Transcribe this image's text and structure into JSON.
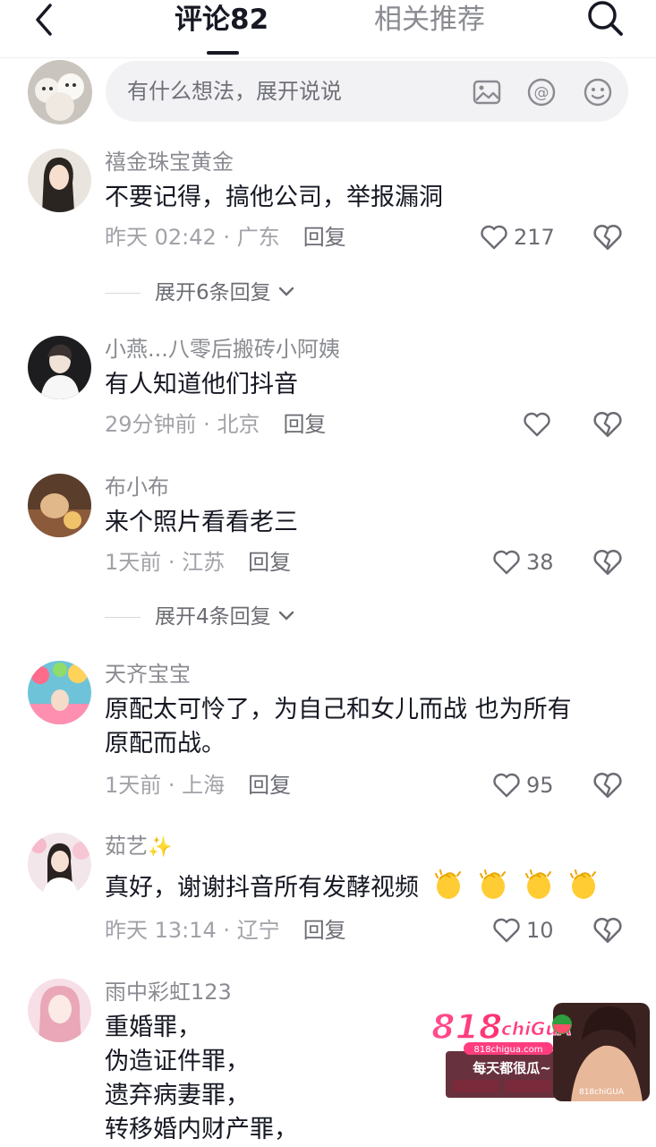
{
  "header": {
    "tab_comments": "评论82",
    "tab_related": "相关推荐"
  },
  "composer": {
    "placeholder": "有什么想法，展开说说"
  },
  "comments": [
    {
      "user": "禧金珠宝黄金",
      "text": "不要记得，搞他公司，举报漏洞",
      "time": "昨天 02:42",
      "location": "广东",
      "reply": "回复",
      "likes": "217",
      "expand": "展开6条回复"
    },
    {
      "user": "小燕...八零后搬砖小阿姨",
      "text": "有人知道他们抖音",
      "time": "29分钟前",
      "location": "北京",
      "reply": "回复",
      "likes": ""
    },
    {
      "user": "布小布",
      "text": "来个照片看看老三",
      "time": "1天前",
      "location": "江苏",
      "reply": "回复",
      "likes": "38",
      "expand": "展开4条回复"
    },
    {
      "user": "天齐宝宝",
      "text": "原配太可怜了，为自己和女儿而战 也为所有\n原配而战。",
      "time": "1天前",
      "location": "上海",
      "reply": "回复",
      "likes": "95"
    },
    {
      "user": "茹艺",
      "text": "真好，谢谢抖音所有发酵视频",
      "time": "昨天 13:14",
      "location": "辽宁",
      "reply": "回复",
      "likes": "10"
    },
    {
      "user": "雨中彩虹123",
      "text": "重婚罪，\n伪造证件罪，\n遗弃病妻罪，\n转移婚内财产罪，"
    }
  ],
  "icons": {
    "back": "back-arrow-icon",
    "search": "search-icon",
    "image": "image-icon",
    "mention": "at-mention-icon",
    "emoji": "emoji-icon",
    "like": "heart-icon",
    "dislike": "broken-heart-icon",
    "expand": "chevron-down-icon",
    "clap": "clapping-hands-emoji",
    "sparkle": "sparkles-emoji"
  },
  "colors": {
    "accent_text": "#161823",
    "secondary_text": "#8a8b91",
    "composer_bg": "#f2f2f4",
    "watermark_pink": "#ff3d7f"
  },
  "watermark": {
    "brand": "818chigua",
    "url": "818chigua.com",
    "slogan": "每天都很瓜~"
  }
}
